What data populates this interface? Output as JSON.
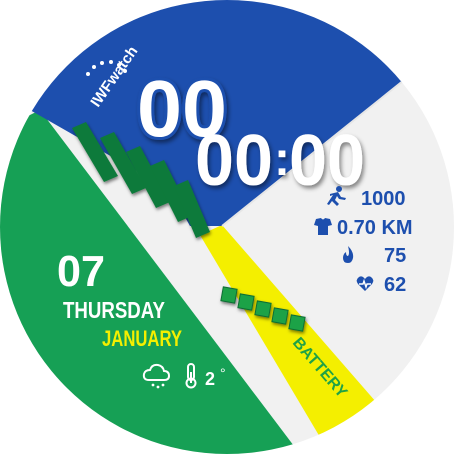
{
  "brand": "IWFwatch",
  "time": {
    "hours": "00",
    "minutes": "00",
    "seconds": "00"
  },
  "date": {
    "day": "07",
    "weekday": "THURSDAY",
    "month": "JANUARY"
  },
  "weather": {
    "temperature": "2",
    "unit": "°",
    "condition_icon": "cloud-snow-icon"
  },
  "stats": {
    "steps": "1000",
    "distance": "0.70 KM",
    "calories": "75",
    "heart_rate": "62"
  },
  "battery": {
    "label": "BATTERY",
    "level_segments_filled": 5,
    "level_segments_total": 5
  },
  "colors": {
    "blue": "#1d4fae",
    "green": "#16a055",
    "yellow": "#f4f000",
    "white": "#f2f2f2",
    "dark_green": "#0f6e35",
    "battery_segment": "#1fa246"
  }
}
